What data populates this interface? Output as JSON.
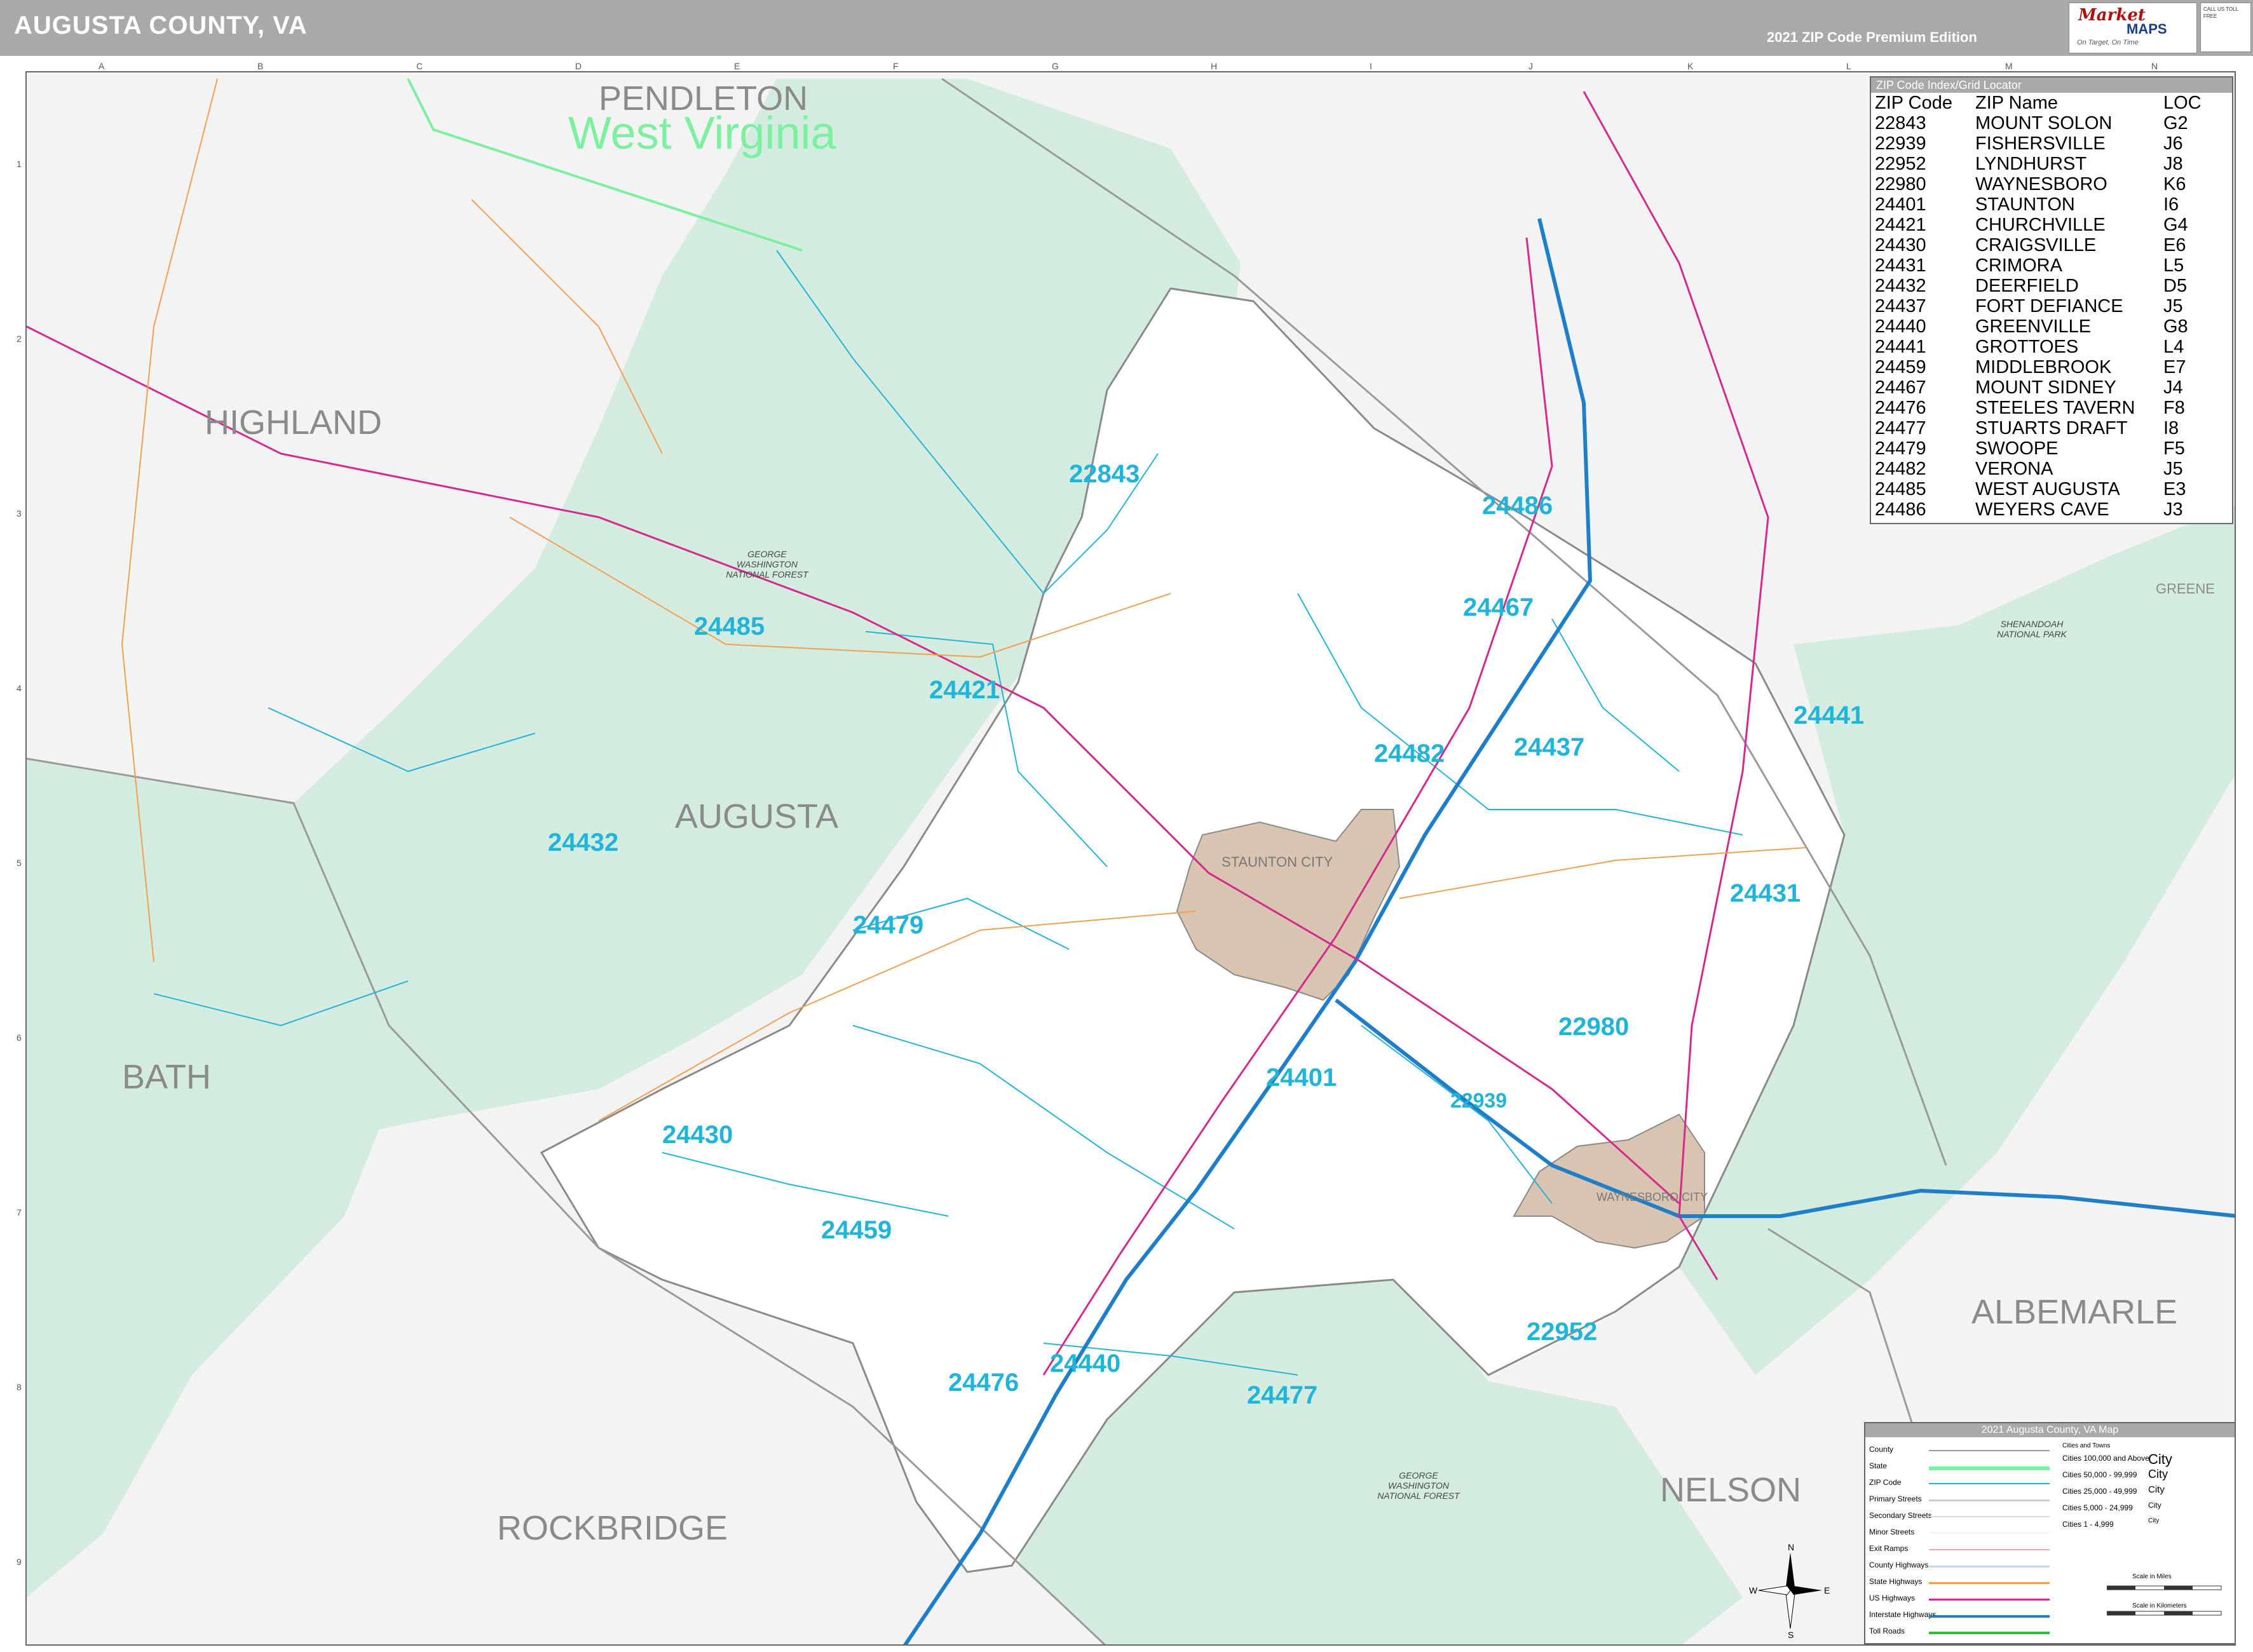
{
  "header": {
    "title": "AUGUSTA COUNTY, VA",
    "edition": "2021 ZIP Code Premium Edition",
    "logo_text_1": "Market",
    "logo_text_2": "MAPS",
    "logo_tagline": "On Target, On Time",
    "logo_side": "CALL US TOLL FREE"
  },
  "grid": {
    "columns": [
      "A",
      "B",
      "C",
      "D",
      "E",
      "F",
      "G",
      "H",
      "I",
      "J",
      "K",
      "L",
      "M",
      "N"
    ],
    "rows": [
      "1",
      "2",
      "3",
      "4",
      "5",
      "6",
      "7",
      "8",
      "9"
    ]
  },
  "counties": {
    "pendleton": "PENDLETON",
    "west_virginia": "West Virginia",
    "highland": "HIGHLAND",
    "augusta": "AUGUSTA",
    "bath": "BATH",
    "rockbridge": "ROCKBRIDGE",
    "nelson": "NELSON",
    "albemarle": "ALBEMARLE",
    "greene": "GREENE"
  },
  "forests": {
    "gw_north": "GEORGE WASHINGTON NATIONAL FOREST",
    "gw_south": "GEORGE WASHINGTON NATIONAL FOREST",
    "shenandoah": "SHENANDOAH NATIONAL PARK"
  },
  "cities": {
    "staunton": "STAUNTON CITY",
    "waynesboro": "WAYNESBORO CITY"
  },
  "zip_labels": [
    "22843",
    "24486",
    "24467",
    "24485",
    "24421",
    "24482",
    "24437",
    "24441",
    "24432",
    "24479",
    "24431",
    "22980",
    "24401",
    "22939",
    "24430",
    "24459",
    "22952",
    "24440",
    "24476",
    "24477"
  ],
  "zip_index": {
    "title": "ZIP Code Index/Grid Locator",
    "headers": [
      "ZIP Code",
      "ZIP Name",
      "LOC"
    ],
    "rows": [
      [
        "22843",
        "MOUNT SOLON",
        "G2"
      ],
      [
        "22939",
        "FISHERSVILLE",
        "J6"
      ],
      [
        "22952",
        "LYNDHURST",
        "J8"
      ],
      [
        "22980",
        "WAYNESBORO",
        "K6"
      ],
      [
        "24401",
        "STAUNTON",
        "I6"
      ],
      [
        "24421",
        "CHURCHVILLE",
        "G4"
      ],
      [
        "24430",
        "CRAIGSVILLE",
        "E6"
      ],
      [
        "24431",
        "CRIMORA",
        "L5"
      ],
      [
        "24432",
        "DEERFIELD",
        "D5"
      ],
      [
        "24437",
        "FORT DEFIANCE",
        "J5"
      ],
      [
        "24440",
        "GREENVILLE",
        "G8"
      ],
      [
        "24441",
        "GROTTOES",
        "L4"
      ],
      [
        "24459",
        "MIDDLEBROOK",
        "E7"
      ],
      [
        "24467",
        "MOUNT SIDNEY",
        "J4"
      ],
      [
        "24476",
        "STEELES TAVERN",
        "F8"
      ],
      [
        "24477",
        "STUARTS DRAFT",
        "I8"
      ],
      [
        "24479",
        "SWOOPE",
        "F5"
      ],
      [
        "24482",
        "VERONA",
        "J5"
      ],
      [
        "24485",
        "WEST AUGUSTA",
        "E3"
      ],
      [
        "24486",
        "WEYERS CAVE",
        "J3"
      ]
    ]
  },
  "legend": {
    "title": "2021 Augusta County, VA Map",
    "items": [
      "County",
      "State",
      "ZIP Code",
      "Primary Streets",
      "Secondary Streets",
      "Minor Streets",
      "Exit Ramps",
      "County Highways",
      "State Highways",
      "US Highways",
      "Interstate Highways",
      "Toll Roads"
    ],
    "city_header": "Cities and Towns",
    "city_classes": [
      "Cities 100,000 and Above",
      "Cities 50,000 - 99,999",
      "Cities 25,000 - 49,999",
      "Cities 5,000 - 24,999",
      "Cities 1 - 4,999"
    ],
    "city_sample": "City",
    "scale_miles": "Scale in Miles",
    "scale_km": "Scale in Kilometers"
  },
  "colors": {
    "zip": "#22b4d8",
    "forest": "#d4ecdf",
    "county_fill": "#ffffff",
    "outside": "#f3f3f3",
    "city_fill": "#d8c4b0",
    "interstate": "#1e7fc8",
    "us_highway": "#d42a8c",
    "state_highway": "#f0a050",
    "state_line": "#7cf0a0"
  },
  "compass": {
    "n": "N",
    "s": "S",
    "e": "E",
    "w": "W"
  }
}
